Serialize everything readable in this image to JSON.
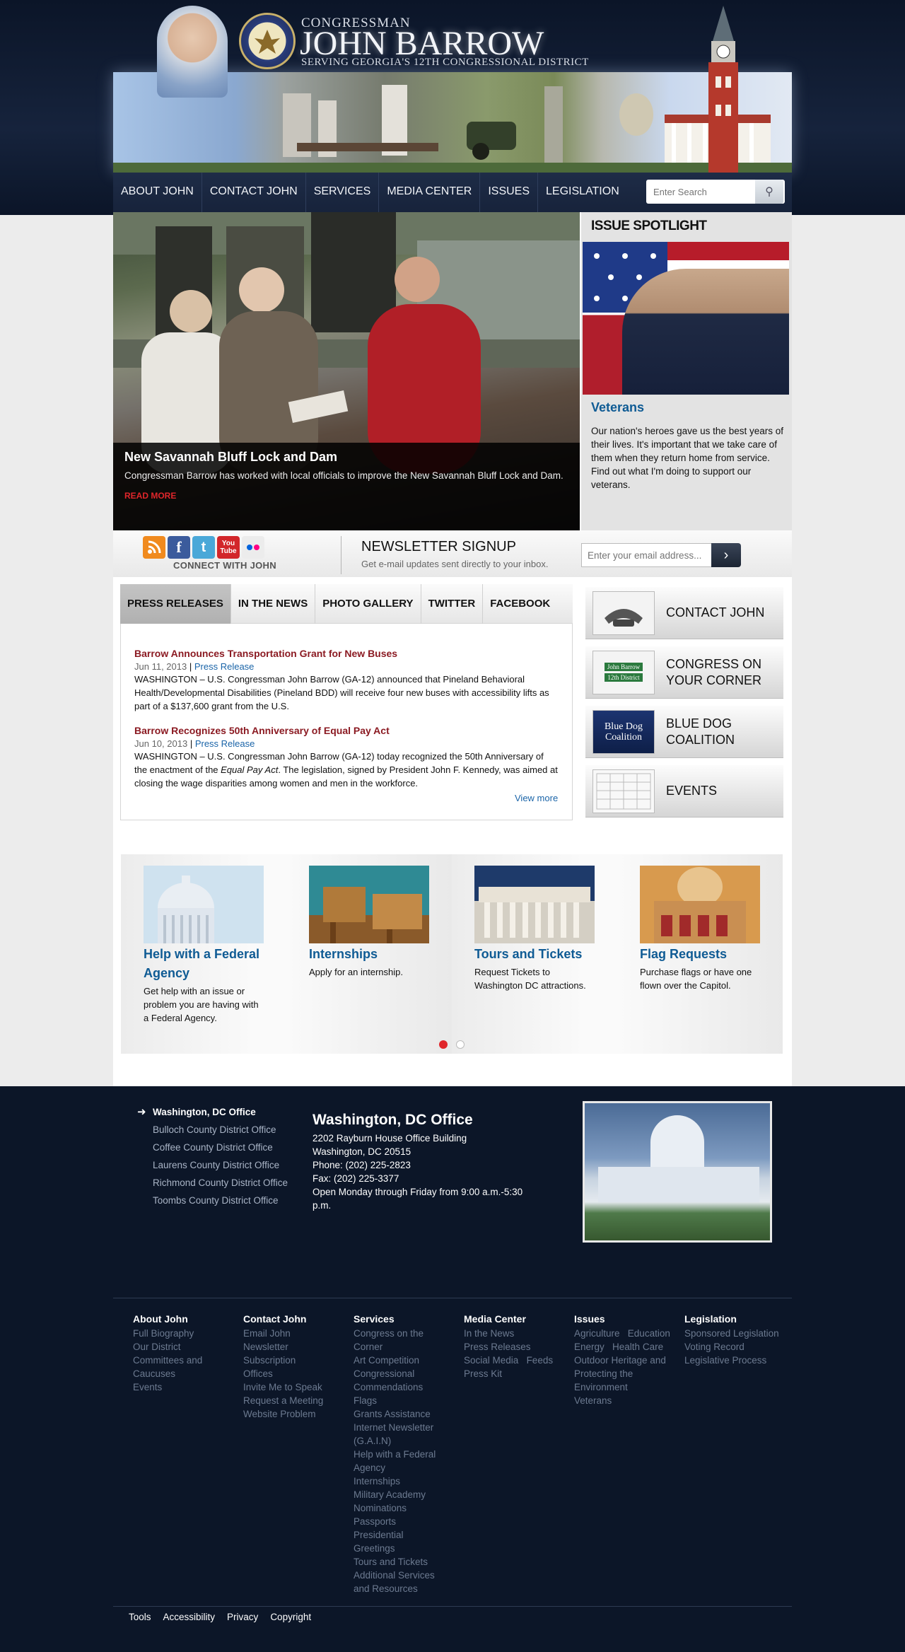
{
  "header": {
    "congressman": "CONGRESSMAN",
    "name": "JOHN BARROW",
    "district": "SERVING GEORGIA'S 12TH CONGRESSIONAL DISTRICT",
    "seal_text": "U.S. HOUSE OF REPRESENTATIVES"
  },
  "nav": {
    "items": [
      "ABOUT JOHN",
      "CONTACT JOHN",
      "SERVICES",
      "MEDIA CENTER",
      "ISSUES",
      "LEGISLATION"
    ],
    "search_placeholder": "Enter Search"
  },
  "slide": {
    "title": "New Savannah Bluff Lock and Dam",
    "description": "Congressman Barrow has worked with local officials to improve the New Savannah Bluff Lock and Dam.",
    "read_more": "READ MORE"
  },
  "spotlight": {
    "heading": "ISSUE SPOTLIGHT",
    "title": "Veterans",
    "text": "Our nation's heroes gave us the best years of their lives. It's important that we take care of them when they return home from service. Find out what I'm doing to support our veterans."
  },
  "connect": {
    "label": "CONNECT WITH JOHN",
    "icons": [
      "rss-icon",
      "facebook-icon",
      "twitter-icon",
      "youtube-icon",
      "flickr-icon"
    ],
    "youtube_text": "You Tube"
  },
  "newsletter": {
    "heading": "NEWSLETTER SIGNUP",
    "subtitle": "Get e-mail updates sent directly to your inbox.",
    "email_placeholder": "Enter your email address..."
  },
  "tabs": {
    "items": [
      "PRESS RELEASES",
      "IN THE NEWS",
      "PHOTO GALLERY",
      "TWITTER",
      "FACEBOOK"
    ],
    "active": "PRESS RELEASES"
  },
  "press": [
    {
      "title": "Barrow Announces Transportation Grant for New Buses",
      "date": "Jun 11, 2013",
      "separator": "|",
      "type": "Press Release",
      "body": "WASHINGTON – U.S. Congressman John Barrow (GA-12) announced that Pineland Behavioral Health/Developmental Disabilities (Pineland BDD) will receive four new buses with accessibility lifts as part of a $137,600 grant from the U.S."
    },
    {
      "title": "Barrow Recognizes 50th Anniversary of Equal Pay Act",
      "date": "Jun 10, 2013",
      "separator": "|",
      "type": "Press Release",
      "body_before": "WASHINGTON – U.S. Congressman John Barrow (GA-12) today recognized the 50th Anniversary of the enactment of the ",
      "body_italic": "Equal Pay Act",
      "body_after": ".  The legislation, signed by President John F. Kennedy, was aimed at closing the wage disparities among women and men in the workforce."
    }
  ],
  "view_more": "View more",
  "side_buttons": [
    {
      "label": "CONTACT JOHN"
    },
    {
      "label": "CONGRESS ON YOUR CORNER",
      "sign_line1": "John Barrow",
      "sign_line2": "12th District"
    },
    {
      "label": "BLUE DOG COALITION",
      "badge": "Blue Dog Coalition"
    },
    {
      "label": "EVENTS"
    }
  ],
  "cards": [
    {
      "title": "Help with a Federal Agency",
      "text": "Get help with an issue or problem you are having with a Federal Agency."
    },
    {
      "title": "Internships",
      "text": "Apply for an internship."
    },
    {
      "title": "Tours and Tickets",
      "text": "Request Tickets to Washington DC attractions."
    },
    {
      "title": "Flag Requests",
      "text": "Purchase flags or have one flown over the Capitol."
    }
  ],
  "carousel": {
    "pages": 2,
    "active_page": 1
  },
  "offices": {
    "list": [
      "Washington, DC Office",
      "Bulloch County District Office",
      "Coffee County District Office",
      "Laurens County District Office",
      "Richmond County District Office",
      "Toombs County District Office"
    ],
    "active": "Washington, DC Office",
    "detail": {
      "title": "Washington, DC Office",
      "lines": [
        "2202 Rayburn House Office Building",
        "Washington, DC 20515",
        "Phone: (202) 225-2823",
        "Fax: (202) 225-3377",
        "Open Monday through Friday from 9:00 a.m.-5:30 p.m."
      ]
    }
  },
  "sitemap": [
    {
      "heading": "About John",
      "items": [
        "Full Biography",
        "Our District",
        "Committees and Caucuses",
        "Events"
      ]
    },
    {
      "heading": "Contact John",
      "items": [
        "Email John",
        "Newsletter Subscription",
        "Offices",
        "Invite Me to Speak",
        "Request a Meeting",
        "Website Problem"
      ]
    },
    {
      "heading": "Services",
      "items": [
        "Congress on the Corner",
        "Art Competition",
        "Congressional Commendations",
        "Flags",
        "Grants Assistance",
        "Internet Newsletter (G.A.I.N)",
        "Help with a Federal Agency",
        "Internships",
        "Military Academy Nominations",
        "Passports",
        "Presidential Greetings",
        "Tours and Tickets",
        "Additional Services and Resources"
      ]
    },
    {
      "heading": "Media Center",
      "items": [
        "In the News",
        "Press Releases",
        "Social Media",
        "Feeds",
        "Press Kit"
      ]
    },
    {
      "heading": "Issues",
      "items": [
        "Agriculture",
        "Education",
        "Energy",
        "Health Care",
        "Outdoor Heritage and Protecting the Environment",
        "Veterans"
      ]
    },
    {
      "heading": "Legislation",
      "items": [
        "Sponsored Legislation",
        "Voting Record",
        "Legislative Process"
      ]
    }
  ],
  "bottom_links": [
    "Tools",
    "Accessibility",
    "Privacy",
    "Copyright"
  ],
  "colors": {
    "navy": "#0c1628",
    "link_blue": "#0f5b94",
    "press_red": "#8b1a22",
    "accent_red": "#e0262b"
  }
}
